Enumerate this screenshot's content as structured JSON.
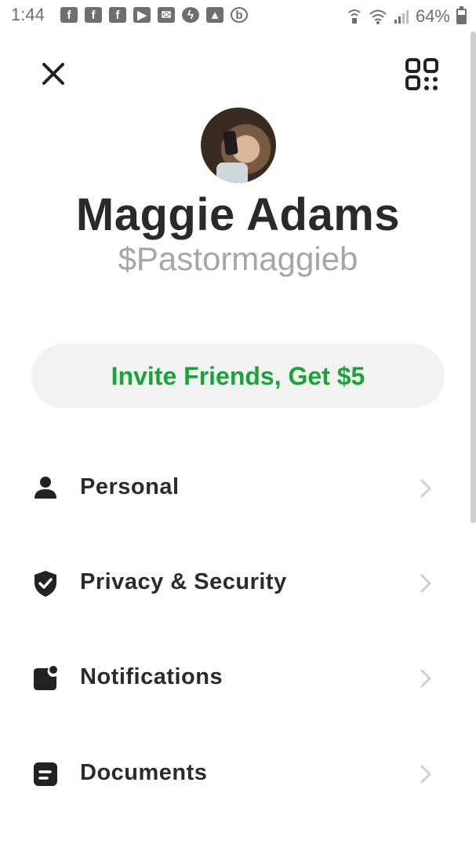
{
  "status_bar": {
    "time": "1:44",
    "battery_percent": "64%",
    "notification_icons": [
      "facebook-icon",
      "facebook-icon",
      "facebook-icon",
      "youtube-icon",
      "mail-icon",
      "messenger-icon",
      "gallery-icon",
      "b-app-icon"
    ],
    "system_icons": [
      "nfc-icon",
      "wifi-icon",
      "signal-icon",
      "battery-icon"
    ],
    "battery_level": 0.64
  },
  "header": {
    "close_icon": "close-icon",
    "qr_icon": "qr-code-icon"
  },
  "profile": {
    "name": "Maggie Adams",
    "cashtag": "$Pastormaggieb"
  },
  "invite": {
    "label": "Invite Friends, Get $5",
    "color": "#1aa338"
  },
  "menu": {
    "items": [
      {
        "label": "Personal",
        "icon": "person-icon"
      },
      {
        "label": "Privacy & Security",
        "icon": "shield-check-icon"
      },
      {
        "label": "Notifications",
        "icon": "notification-badge-icon"
      },
      {
        "label": "Documents",
        "icon": "document-icon"
      }
    ]
  }
}
